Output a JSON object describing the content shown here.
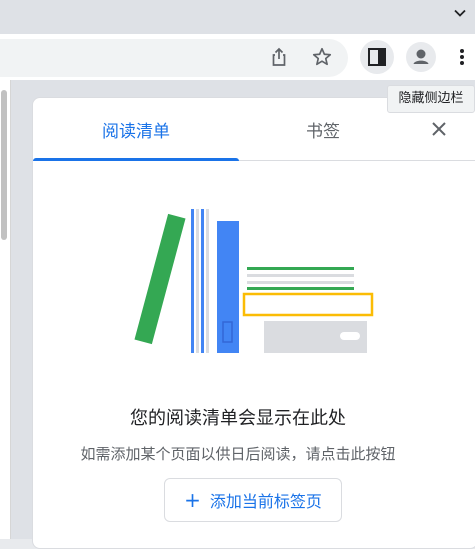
{
  "browser": {
    "tooltip": "隐藏侧边栏",
    "icons": {
      "tabstrip": "chevron-down-icon",
      "share": "share-icon",
      "bookmark": "star-icon",
      "side_panel": "side-panel-icon",
      "profile": "profile-avatar-icon",
      "menu": "more-vert-icon"
    }
  },
  "side_panel": {
    "tabs": [
      {
        "label": "阅读清单",
        "selected": true
      },
      {
        "label": "书签",
        "selected": false
      }
    ],
    "close_icon": "close-icon",
    "empty_state": {
      "title": "您的阅读清单会显示在此处",
      "subtitle": "如需添加某个页面以供日后阅读，请点击此按钮",
      "button_label": "添加当前标签页",
      "button_icon": "plus-icon"
    }
  },
  "colors": {
    "accent": "#1a73e8",
    "green": "#34a853",
    "yellow": "#fbbc04",
    "gray": "#dadce0"
  }
}
